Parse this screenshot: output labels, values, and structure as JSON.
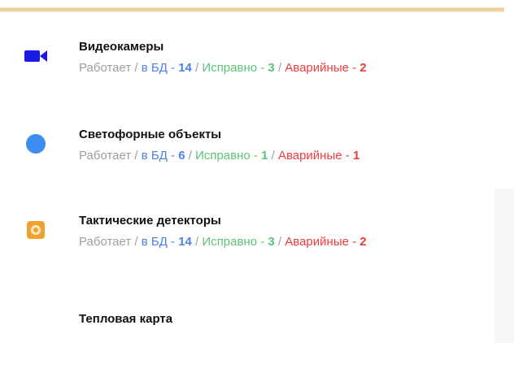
{
  "layers": [
    {
      "title": "Видеокамеры",
      "icon": "video-camera-icon",
      "working_label": "Работает",
      "db_label": "в БД - ",
      "db_value": "14",
      "ok_label": "Исправно - ",
      "ok_value": "3",
      "alarm_label": "Аварийные - ",
      "alarm_value": "2"
    },
    {
      "title": "Светофорные объекты",
      "icon": "traffic-light-dot-icon",
      "working_label": "Работает",
      "db_label": "в БД - ",
      "db_value": "6",
      "ok_label": "Исправно - ",
      "ok_value": "1",
      "alarm_label": "Аварийные - ",
      "alarm_value": "1"
    },
    {
      "title": "Тактические детекторы",
      "icon": "detector-icon",
      "working_label": "Работает",
      "db_label": "в БД - ",
      "db_value": "14",
      "ok_label": "Исправно - ",
      "ok_value": "3",
      "alarm_label": "Аварийные - ",
      "alarm_value": "2"
    },
    {
      "title": "Тепловая карта"
    }
  ],
  "colors": {
    "camera": "#1a1ae6",
    "traffic_light": "#3d8cf0",
    "detector": "#f0a22e",
    "db": "#4f81e8",
    "ok": "#5fc27a",
    "alarm": "#ee3b3b",
    "muted": "#9e9e9e"
  }
}
